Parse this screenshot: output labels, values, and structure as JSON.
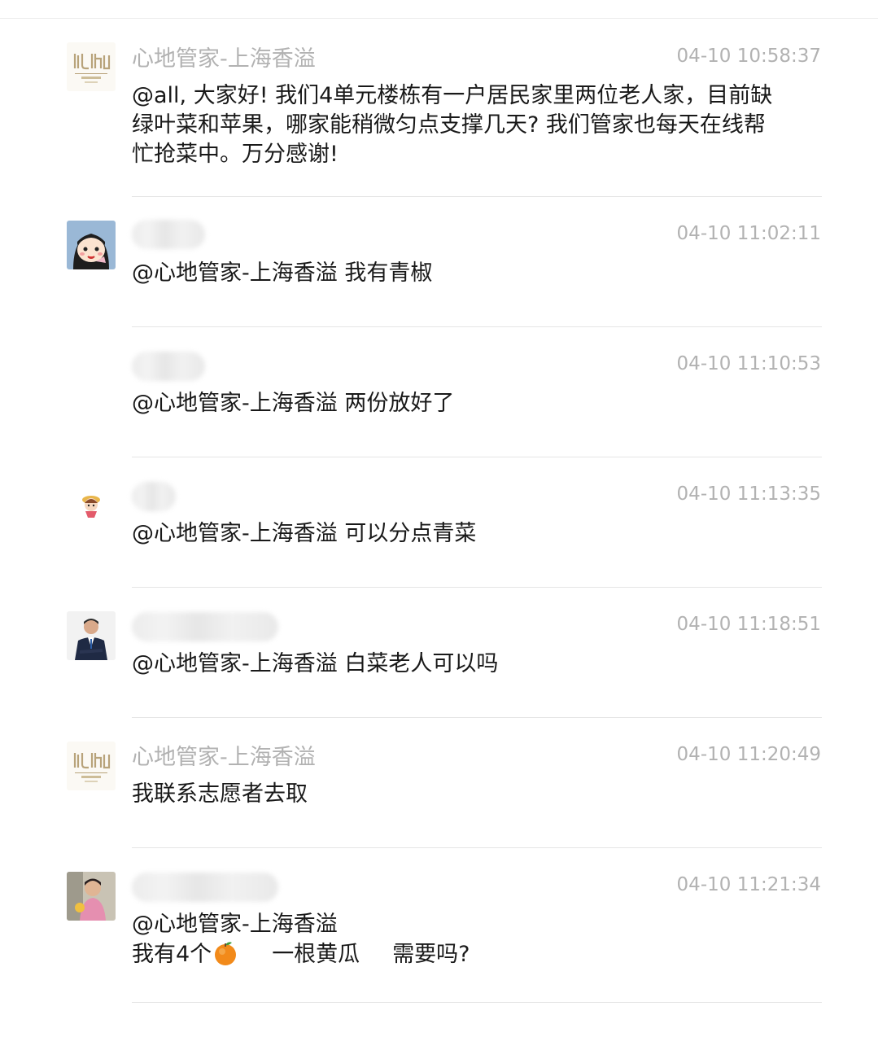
{
  "messages": [
    {
      "sender": "心地管家-上海香溢",
      "time": "04-10 10:58:37",
      "text": "@all, 大家好! 我们4单元楼栋有一户居民家里两位老人家，目前缺绿叶菜和苹果，哪家能稍微匀点支撑几天? 我们管家也每天在线帮忙抢菜中。万分感谢!"
    },
    {
      "time": "04-10 11:02:11",
      "text": "@心地管家-上海香溢 我有青椒"
    },
    {
      "time": "04-10 11:10:53",
      "text": "@心地管家-上海香溢 两份放好了"
    },
    {
      "time": "04-10 11:13:35",
      "text": "@心地管家-上海香溢 可以分点青菜"
    },
    {
      "time": "04-10 11:18:51",
      "text": "@心地管家-上海香溢 白菜老人可以吗"
    },
    {
      "sender": "心地管家-上海香溢",
      "time": "04-10 11:20:49",
      "text": "我联系志愿者去取"
    },
    {
      "time": "04-10 11:21:34",
      "line1": "@心地管家-上海香溢",
      "line2_part1": "我有4个",
      "line2_part2": "一根黄瓜",
      "line2_part3": "需要吗?",
      "emoji": "tangerine-emoji"
    }
  ],
  "colors": {
    "sender_gray": "#b2b2b2",
    "text_dark": "#191919",
    "divider": "#e5e5e5",
    "logo_gold": "#b8a37a"
  }
}
